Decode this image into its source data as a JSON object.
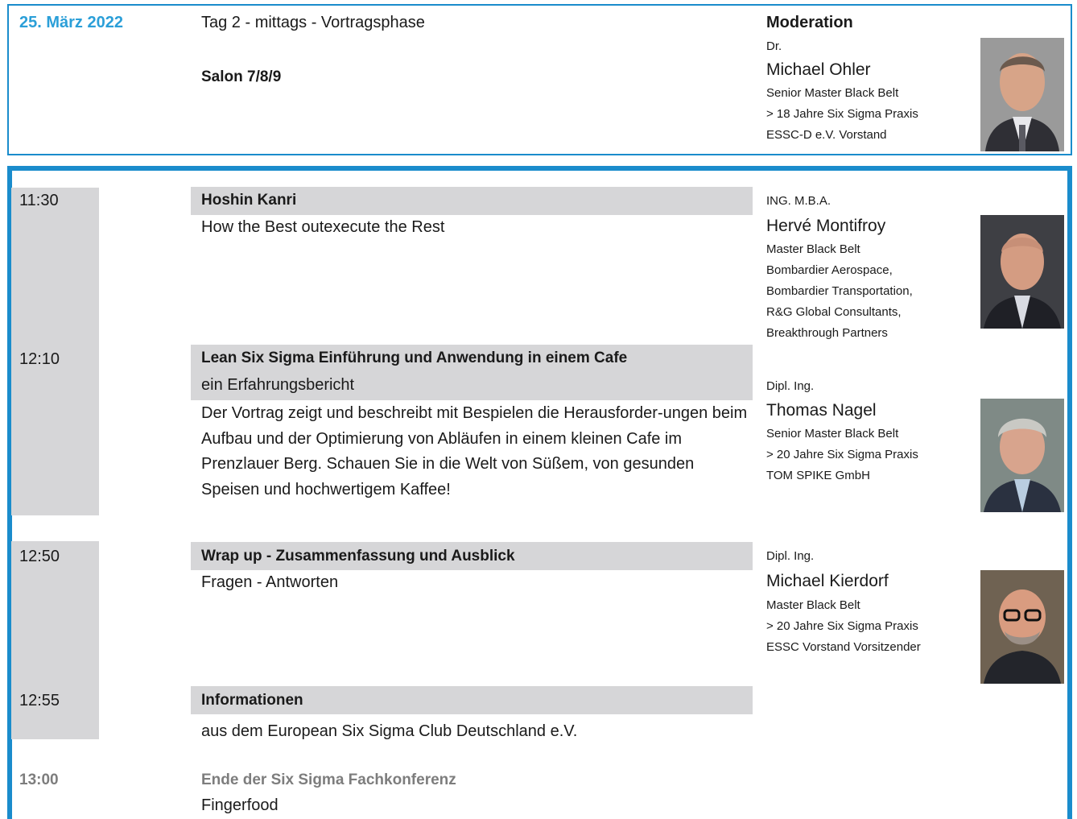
{
  "header": {
    "date": "25. März 2022",
    "day_line": "Tag 2 - mittags - Vortragsphase",
    "room": "Salon 7/8/9",
    "moderation": {
      "heading": "Moderation",
      "title": "Dr.",
      "name": "Michael Ohler",
      "roles": [
        "Senior Master Black Belt",
        "> 18 Jahre Six Sigma Praxis",
        "ESSC-D e.V. Vorstand"
      ],
      "photo_icon": "portrait-photo"
    }
  },
  "agenda": [
    {
      "time": "11:30",
      "title": "Hoshin Kanri",
      "subtitle": "How the Best outexecute the Rest",
      "speaker": {
        "title": "ING. M.B.A.",
        "name": "Hervé Montifroy",
        "roles": [
          "Master Black Belt",
          "Bombardier Aerospace,",
          "Bombardier Transportation,",
          "R&G Global Consultants,",
          "Breakthrough Partners"
        ]
      }
    },
    {
      "time": "12:10",
      "title": "Lean Six Sigma Einführung und Anwendung in einem Cafe",
      "subtitle": "ein Erfahrungsbericht",
      "description": "Der Vortrag zeigt und beschreibt mit Bespielen die Herausforder-ungen beim Aufbau und der Optimierung von Abläufen in einem kleinen Cafe im Prenzlauer Berg. Schauen Sie in die Welt von Süßem, von gesunden Speisen und hochwertigem Kaffee!",
      "speaker": {
        "title": "Dipl. Ing.",
        "name": "Thomas Nagel",
        "roles": [
          "Senior Master Black Belt",
          "> 20 Jahre Six Sigma Praxis",
          "TOM SPIKE GmbH"
        ]
      }
    },
    {
      "time": "12:50",
      "title": "Wrap up - Zusammenfassung und Ausblick",
      "subtitle": "Fragen - Antworten",
      "speaker": {
        "title": "Dipl. Ing.",
        "name": "Michael Kierdorf",
        "roles": [
          "Master Black Belt",
          "> 20 Jahre Six Sigma Praxis",
          "ESSC Vorstand Vorsitzender"
        ]
      }
    },
    {
      "time": "12:55",
      "title": "Informationen",
      "subtitle": "aus dem European Six Sigma Club Deutschland e.V."
    },
    {
      "time": "13:00",
      "title": "Ende der Six Sigma Fachkonferenz",
      "subtitle": "Fingerfood"
    }
  ],
  "colors": {
    "accent": "#1a8ccc",
    "date_blue": "#2b9fd8",
    "bar_gray": "#d6d6d8",
    "muted_text": "#7d7d7d"
  }
}
